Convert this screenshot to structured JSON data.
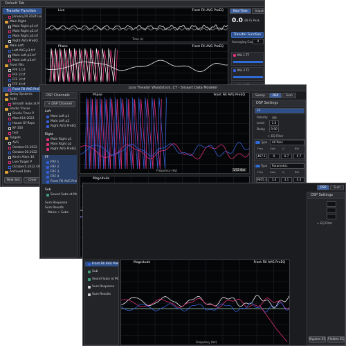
{
  "colors": {
    "accent": "#2d4f8a",
    "trace_pink": "#e0307a",
    "trace_blue": "#3560d8",
    "trace_white": "#f2f2f2",
    "trace_green": "#3fa07a",
    "folder": "#e0a238"
  },
  "back_window": {
    "title": "Default Tab",
    "transfer_panel_title": "Transfer Function",
    "items": [
      "January10.2024 Loss Center",
      "Main Right",
      "Main Right p1.trf",
      "Main Right p2.trf",
      "Main Right p3.trf",
      "Right AVG PreEQ",
      "Main Left",
      "Left AVG p1.trf",
      "Main Left p2.trf",
      "Main Left p3.trf",
      "Front Fills",
      "FFF 1.trf",
      "FFF 2.trf",
      "FFF 3.trf",
      "FFF 4.trf",
      "Front Fill AVG PreEQ",
      "Delay Systems",
      "Subs",
      "Smooth Subs at Main p2.trf",
      "Studio Traces",
      "Studio Trace P",
      "March14.2023",
      "House Of Reps",
      "KF 350",
      "test",
      "Targets",
      "AVG",
      "October25.2022",
      "October20.2022",
      "Kevin Alam 16",
      "Live Target P",
      "October5.2022 OM Testing",
      "Archived Data"
    ],
    "buttons": {
      "new": "New Set",
      "clear": "Clear"
    },
    "top_plot": {
      "title": "Live",
      "trace": "Front Fill AVG PreEQ",
      "x_label": "Time (s)",
      "y_label": "Amplitude"
    },
    "mid_plot": {
      "title": "Phase",
      "trace": "Front Fill AVG PreEQ"
    },
    "top_tabs": [
      "Live",
      "Real Time",
      "Impulse",
      "Info"
    ],
    "readout": {
      "value": "0.0",
      "label": "dB FS Peak",
      "sub": "Peak Hold"
    },
    "tf_panel": {
      "title": "Transfer Function",
      "averaging": "Averaging Count",
      "avg_value": "4"
    },
    "channels": [
      "Mic 1 TF",
      "Mic 2 TF",
      "Mic 3 TF"
    ]
  },
  "mid_window": {
    "title": "Loss Theater Woodstock, CT - Smaart Data Modeler",
    "left_title": "DSP Channels",
    "new_channel": "+ DSP Channel",
    "groups": [
      {
        "name": "Left",
        "items": [
          "Main Left p1",
          "Main Left p2",
          "Right AVG PreEQ"
        ]
      },
      {
        "name": "Right",
        "items": [
          "Main Right p1",
          "Main Right p2",
          "Right AVG PreEQ"
        ]
      },
      {
        "name": "FF",
        "items": [
          "FRF 1",
          "FRF 2",
          "FRF 3",
          "FRF 4",
          "Front Fill AVG PreEQ"
        ]
      },
      {
        "name": "Sub",
        "items": [
          "Sound Subs at Main p2"
        ]
      }
    ],
    "sum": {
      "title": "Sum Response",
      "results": "Sum Results",
      "line": "Mains + Subs"
    },
    "phase_plot": {
      "title": "Phase",
      "trace": "Front Fill AVG PreEQ",
      "x_label": "Frequency (Hz)",
      "y_label": "Phase (deg)",
      "badge": "1/12 Oct"
    },
    "mag_plot": {
      "title": "Magnitude",
      "trace": "Front Fill AVG PreEQ",
      "x_label": "Frequency (Hz)",
      "y_label": "Level (dB)",
      "badge": "1/6 Oct"
    },
    "x_ticks": [
      "31.5",
      "63",
      "125",
      "250",
      "500",
      "1k",
      "2k",
      "4k",
      "8k",
      "16k"
    ],
    "right_tabs": [
      "Sweep",
      "DSP",
      "Sum"
    ],
    "dsp": {
      "title": "DSP Settings",
      "channel": "FF",
      "polarity_label": "Polarity",
      "level_label": "Level",
      "level_value": "1.0",
      "delay_label": "Delay",
      "delay_value": "0.00",
      "eq_label": "+ EQ Filter",
      "filters": [
        {
          "type": "All Pass",
          "freq": "467.1",
          "gain": "0",
          "q": "0.7",
          "bw": "0.7"
        },
        {
          "type": "Parametric",
          "freq": "9605.3",
          "gain": "3.4",
          "q": "3.1",
          "bw": "0.3"
        },
        {
          "type": "Parametric",
          "freq": "1136.0",
          "gain": "-6.5",
          "q": "3.0",
          "bw": "0.5"
        },
        {
          "type": "Parametric",
          "freq": "287.5",
          "gain": "10.6",
          "q": "1.2",
          "bw": "1.2"
        },
        {
          "type": "HPF Linkwitz-Riley",
          "freq": "88.8",
          "gain": "24",
          "q": "",
          "bw": ""
        }
      ],
      "filter_headers": [
        "Freq",
        "Gain",
        "Q",
        "BW"
      ],
      "type_label": "Type",
      "bottom_buttons": [
        "Bypass EQ",
        "Flatten EQ"
      ]
    }
  },
  "front_window": {
    "groups": [
      "Front Fill AVG PreEQ",
      "Sub",
      "Sound Subs at Main p2",
      "Sum Response",
      "Sum Results"
    ],
    "mag_plot": {
      "title": "Magnitude",
      "trace": "Front Fill AVG PreEQ",
      "x_label": "Frequency (Hz)",
      "y_label": "Level (dB)"
    },
    "right_tabs": [
      "DSP",
      "Sum"
    ],
    "dsp_title": "DSP Settings",
    "eq_label": "+ EQ Filter",
    "bottom_buttons": [
      "Bypass EQ",
      "Flatten EQ"
    ]
  }
}
